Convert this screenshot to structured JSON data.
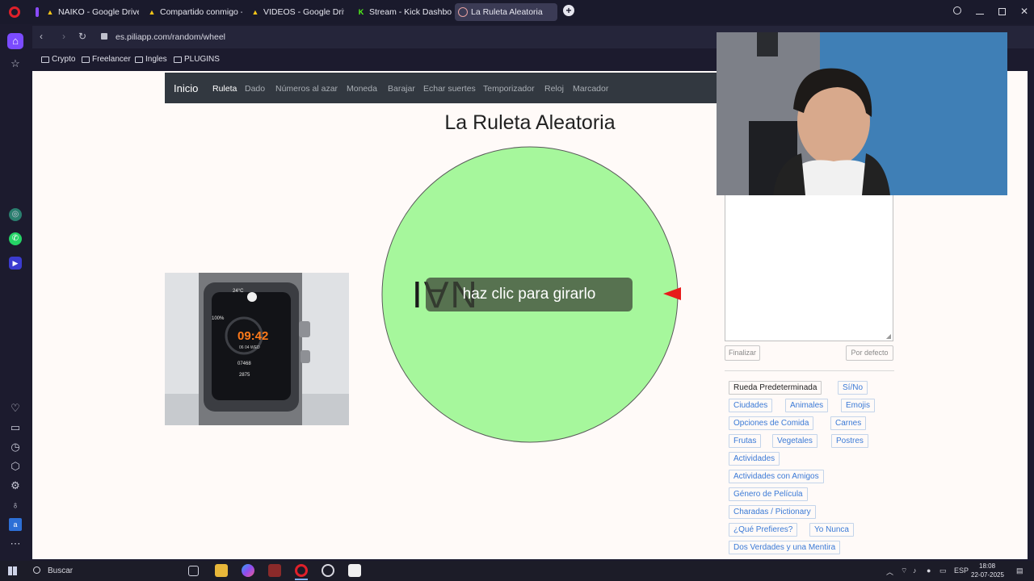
{
  "browser": {
    "tabs": [
      {
        "label": "NAIKO - Google Drive",
        "favicon": "drive-icon"
      },
      {
        "label": "Compartido conmigo - Go",
        "favicon": "drive-icon"
      },
      {
        "label": "VIDEOS - Google Drive",
        "favicon": "drive-icon"
      },
      {
        "label": "Stream - Kick Dashboard",
        "favicon": "kick-icon"
      },
      {
        "label": "La Ruleta Aleatoria",
        "favicon": "wheel-icon"
      }
    ],
    "new_tab": "+",
    "url": "es.piliapp.com/random/wheel",
    "bookmarks": [
      "Crypto",
      "Freelancer",
      "Ingles",
      "PLUGINS"
    ]
  },
  "site": {
    "brand": "Inicio",
    "nav": [
      "Ruleta",
      "Dado",
      "Números al azar",
      "Moneda",
      "Barajar",
      "Echar suertes",
      "Temporizador",
      "Reloj",
      "Marcador"
    ],
    "title": "La Ruleta Aleatoria",
    "wheel_label": "NAI",
    "spin_hint": "haz clic para girarlo",
    "wheel_color": "#a6f79c",
    "pointer_color": "#e81b1b",
    "finalize_button": "Finalizar",
    "default_button": "Por defecto",
    "presets": [
      "Rueda Predeterminada",
      "Sí/No",
      "Ciudades",
      "Animales",
      "Emojis",
      "Opciones de Comida",
      "Carnes",
      "Frutas",
      "Vegetales",
      "Postres",
      "Actividades",
      "Actividades con Amigos",
      "Género de Película",
      "Charadas / Pictionary",
      "¿Qué Prefieres?",
      "Yo Nunca",
      "Dos Verdades y una Mentira"
    ],
    "ad_watch": {
      "time": "09:42",
      "date": "06 04 WED",
      "temp": "24°C",
      "steps": "07468",
      "cal": "2875",
      "battery": "100%"
    }
  },
  "taskbar": {
    "search_label": "Buscar",
    "language": "ESP",
    "time": "18:08",
    "date": "22-07-2025"
  }
}
